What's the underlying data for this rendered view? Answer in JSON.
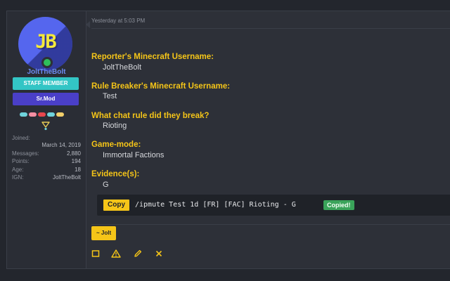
{
  "post": {
    "timestamp": "Yesterday at 5:03 PM"
  },
  "user": {
    "avatar_letters": "JB",
    "name": "JoltTheBolt",
    "staff_badge": "STAFF MEMBER",
    "role_badge": "Sr.Mod",
    "badge_dot_colors": [
      "#6fd3dc",
      "#f58fa3",
      "#e8474e",
      "#6fd3dc",
      "#f2cf6a"
    ],
    "stats": [
      {
        "label": "Joined:",
        "value": "March 14, 2019"
      },
      {
        "label": "Messages:",
        "value": "2,880"
      },
      {
        "label": "Points:",
        "value": "194"
      },
      {
        "label": "Age:",
        "value": "18"
      },
      {
        "label": "IGN:",
        "value": "JoltTheBolt"
      }
    ]
  },
  "report": {
    "fields": [
      {
        "label": "Reporter's Minecraft Username:",
        "value": "JoltTheBolt"
      },
      {
        "label": "Rule Breaker's Minecraft Username:",
        "value": "Test"
      },
      {
        "label": "What chat rule did they break?",
        "value": "Rioting"
      },
      {
        "label": "Game-mode:",
        "value": "Immortal Factions"
      },
      {
        "label": "Evidence(s):",
        "value": "G"
      }
    ]
  },
  "code": {
    "copy_label": "Copy",
    "command": "/ipmute Test 1d [FR] [FAC] Rioting - G",
    "copied_label": "Copied!"
  },
  "signature": {
    "label": "~ Jolt"
  },
  "actions": [
    {
      "name": "select-icon"
    },
    {
      "name": "report-icon"
    },
    {
      "name": "edit-icon"
    },
    {
      "name": "delete-icon"
    }
  ],
  "colors": {
    "accent": "#f5c518",
    "username": "#6d8cf2",
    "staff": "#33c5c5",
    "role": "#4a3fc8",
    "copied": "#3aa35a"
  }
}
